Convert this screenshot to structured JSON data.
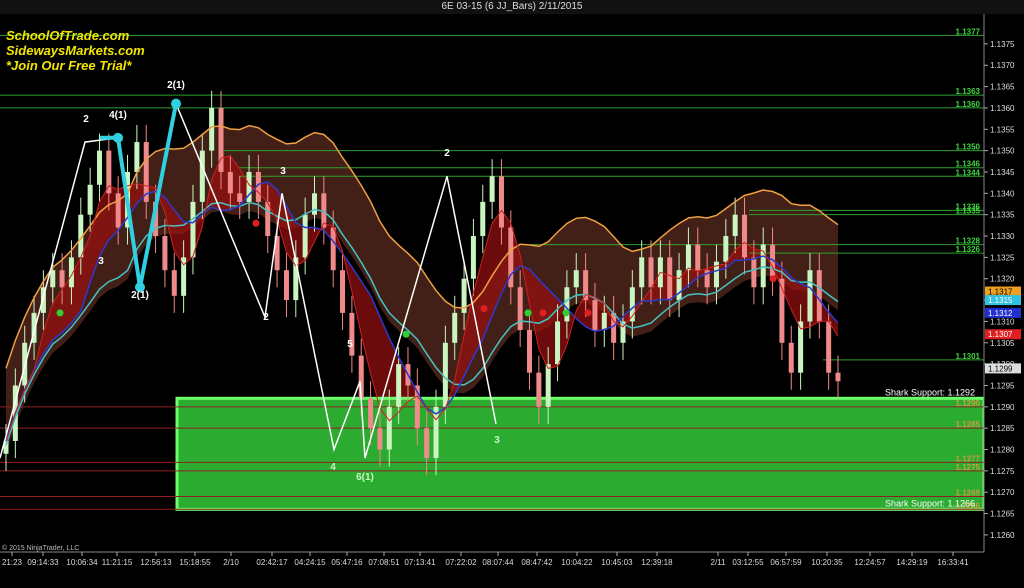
{
  "window": {
    "title": "6E 03-15 (6 JJ_Bars)  2/11/2015"
  },
  "branding": {
    "line1": "SchoolOfTrade.com",
    "line2": "SidewaysMarkets.com",
    "line3": "*Join Our Free Trial*",
    "copyright": "© 2015 NinjaTrader, LLC"
  },
  "colors": {
    "background": "#000000",
    "support_zone": "#35d13a",
    "bull_bar": "#c9f5c0",
    "bear_bar": "#f08a8a",
    "orange_band": "#f0a040",
    "blue_ma": "#2a3acc",
    "cyan_ma": "#46c3c3",
    "red_ma": "#d02020",
    "level_green": "#3fd63f",
    "level_red": "#b02020",
    "zigzag_white": "#ffffff",
    "zigzag_cyan": "#30d0e0"
  },
  "chart_data": {
    "type": "candlestick",
    "instrument": "6E 03-15",
    "ylim": [
      1.1256,
      1.1382
    ],
    "y_ticks": [
      "1.1375",
      "1.1370",
      "1.1365",
      "1.1360",
      "1.1355",
      "1.1350",
      "1.1345",
      "1.1340",
      "1.1335",
      "1.1330",
      "1.1325",
      "1.1320",
      "1.1315",
      "1.1310",
      "1.1305",
      "1.1300",
      "1.1295",
      "1.1290",
      "1.1285",
      "1.1280",
      "1.1275",
      "1.1270",
      "1.1265",
      "1.1260"
    ],
    "x_ticks": [
      "21:23",
      "09:14:33",
      "10:06:34",
      "11:21:15",
      "12:56:13",
      "15:18:55",
      "2/10",
      "02:42:17",
      "04:24:15",
      "05:47:16",
      "07:08:51",
      "07:13:41",
      "07:22:02",
      "08:07:44",
      "08:47:42",
      "10:04:22",
      "10:45:03",
      "12:39:18",
      "2/11",
      "03:12:55",
      "06:57:59",
      "10:20:35",
      "12:24:57",
      "14:29:19",
      "16:33:41"
    ],
    "closes": [
      1.1282,
      1.1295,
      1.1305,
      1.1312,
      1.1318,
      1.1322,
      1.1318,
      1.1325,
      1.1335,
      1.1342,
      1.135,
      1.134,
      1.1332,
      1.1345,
      1.1352,
      1.1338,
      1.133,
      1.1322,
      1.1316,
      1.1325,
      1.1338,
      1.135,
      1.136,
      1.1345,
      1.134,
      1.1338,
      1.1345,
      1.1338,
      1.133,
      1.1322,
      1.1315,
      1.1325,
      1.1335,
      1.134,
      1.1332,
      1.1322,
      1.1312,
      1.1302,
      1.1292,
      1.1285,
      1.128,
      1.129,
      1.13,
      1.1295,
      1.1285,
      1.1278,
      1.129,
      1.1305,
      1.1312,
      1.132,
      1.133,
      1.1338,
      1.1344,
      1.1332,
      1.1318,
      1.1308,
      1.1298,
      1.129,
      1.13,
      1.131,
      1.1318,
      1.1322,
      1.1315,
      1.1308,
      1.1312,
      1.1305,
      1.131,
      1.1318,
      1.1325,
      1.1318,
      1.1325,
      1.1315,
      1.1322,
      1.1328,
      1.1322,
      1.1318,
      1.1324,
      1.133,
      1.1335,
      1.1325,
      1.1318,
      1.1328,
      1.132,
      1.1305,
      1.1298,
      1.131,
      1.1322,
      1.131,
      1.1298,
      1.1296
    ],
    "price_labels": [
      {
        "label": "1.1377",
        "value": 1.1377,
        "color": "#3fd63f"
      },
      {
        "label": "1.1363",
        "value": 1.1363,
        "color": "#3fd63f"
      },
      {
        "label": "1.1360",
        "value": 1.136,
        "color": "#3fd63f"
      },
      {
        "label": "1.1350",
        "value": 1.135,
        "color": "#3fd63f"
      },
      {
        "label": "1.1346",
        "value": 1.1346,
        "color": "#3fd63f"
      },
      {
        "label": "1.1344",
        "value": 1.1344,
        "color": "#3fd63f"
      },
      {
        "label": "1.1336",
        "value": 1.1336,
        "color": "#3fd63f"
      },
      {
        "label": "1.1335",
        "value": 1.1335,
        "color": "#3fd63f"
      },
      {
        "label": "1.1328",
        "value": 1.1328,
        "color": "#3fd63f"
      },
      {
        "label": "1.1326",
        "value": 1.1326,
        "color": "#3fd63f"
      },
      {
        "label": "1.1301",
        "value": 1.1301,
        "color": "#3fd63f"
      },
      {
        "label": "1.1290",
        "value": 1.129,
        "color": "#c8a040"
      },
      {
        "label": "1.1285",
        "value": 1.1285,
        "color": "#c8a040"
      },
      {
        "label": "1.1277",
        "value": 1.1277,
        "color": "#c8a040"
      },
      {
        "label": "1.1275",
        "value": 1.1275,
        "color": "#c8a040"
      },
      {
        "label": "1.1269",
        "value": 1.1269,
        "color": "#c8a040"
      },
      {
        "label": "1.1266",
        "value": 1.1266,
        "color": "#c8a040"
      }
    ],
    "axis_boxes": [
      {
        "label": "1.1317",
        "value": 1.1317,
        "color": "#f0a020"
      },
      {
        "label": "1.1315",
        "value": 1.1315,
        "color": "#30c0e0"
      },
      {
        "label": "1.1312",
        "value": 1.1312,
        "color": "#2030d0"
      },
      {
        "label": "1.1307",
        "value": 1.1307,
        "color": "#e02020"
      },
      {
        "label": "1.1299",
        "value": 1.1299,
        "color": "#dddddd"
      }
    ],
    "shark_support": [
      {
        "label": "Shark Support: 1.1292",
        "value": 1.1292
      },
      {
        "label": "Shark Support: 1.1266",
        "value": 1.1266
      }
    ],
    "support_zone": {
      "low": 1.1266,
      "high": 1.1292
    },
    "zigzag_labels": [
      "2",
      "4(1)",
      "2(1)",
      "3",
      "2(1)",
      "3",
      "2",
      "5",
      "4",
      "6(1)",
      "2",
      "3"
    ]
  }
}
